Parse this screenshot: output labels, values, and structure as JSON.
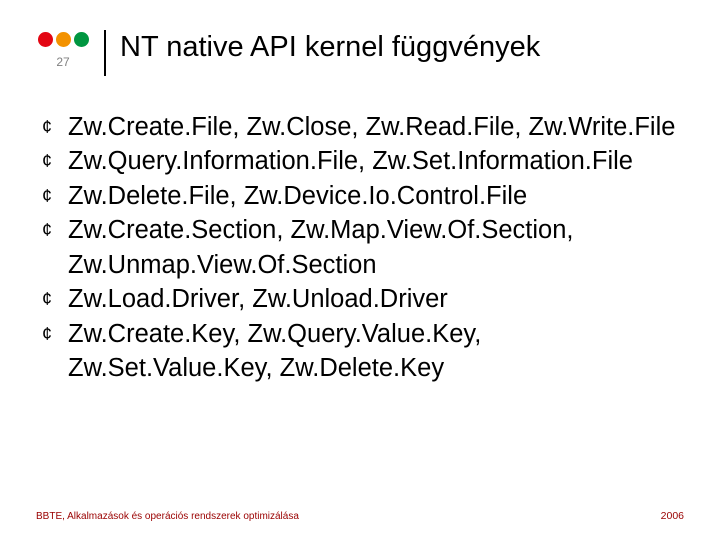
{
  "colors": {
    "dot_red": "#e30613",
    "dot_orange": "#f39200",
    "dot_green": "#009640",
    "footer": "#9a0000"
  },
  "slide_number": "27",
  "title": "NT native API kernel függvények",
  "bullets": [
    "Zw.Create.File, Zw.Close, Zw.Read.File, Zw.Write.File",
    "Zw.Query.Information.File, Zw.Set.Information.File",
    "Zw.Delete.File, Zw.Device.Io.Control.File",
    "Zw.Create.Section, Zw.Map.View.Of.Section, Zw.Unmap.View.Of.Section",
    "Zw.Load.Driver, Zw.Unload.Driver",
    "Zw.Create.Key, Zw.Query.Value.Key, Zw.Set.Value.Key, Zw.Delete.Key"
  ],
  "footer_left": "BBTE, Alkalmazások és operációs rendszerek optimizálása",
  "footer_right": "2006"
}
